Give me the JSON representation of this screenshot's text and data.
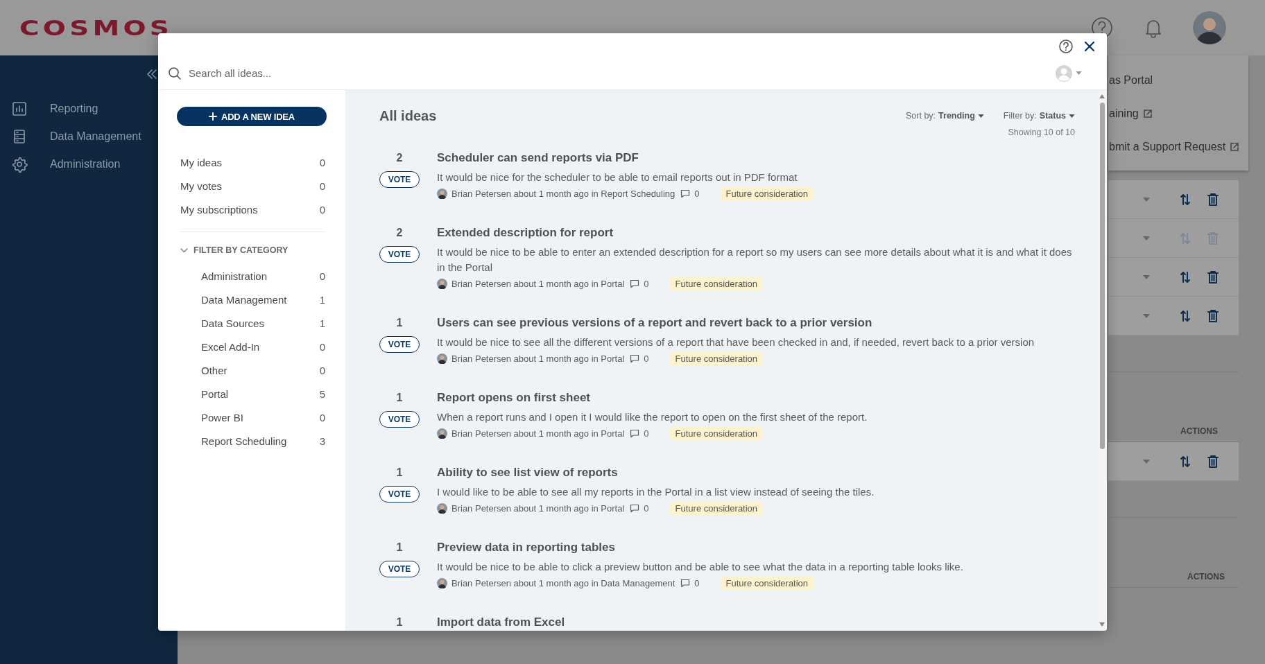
{
  "header": {
    "logo": "COSMOS"
  },
  "sidebar": {
    "items": [
      {
        "label": "Reporting"
      },
      {
        "label": "Data Management"
      },
      {
        "label": "Administration"
      }
    ]
  },
  "help_menu": {
    "items": [
      {
        "label": "as Portal",
        "external": false
      },
      {
        "label": "aining",
        "external": true
      },
      {
        "label": "bmit a Support Request",
        "external": true
      }
    ]
  },
  "background_tables": [
    {
      "rows": [
        {
          "disabled": false
        },
        {
          "disabled": true
        },
        {
          "disabled": false
        },
        {
          "disabled": false
        }
      ]
    },
    {
      "actions_header": "ACTIONS",
      "rows": [
        {
          "disabled": false
        }
      ]
    },
    {
      "actions_header": "ACTIONS"
    }
  ],
  "ideas_modal": {
    "search": {
      "placeholder": "Search all ideas..."
    },
    "add_button": "ADD A NEW IDEA",
    "my_lists": [
      {
        "label": "My ideas",
        "count": "0"
      },
      {
        "label": "My votes",
        "count": "0"
      },
      {
        "label": "My subscriptions",
        "count": "0"
      }
    ],
    "category_filter": {
      "title": "FILTER BY CATEGORY",
      "expanded": true,
      "categories": [
        {
          "label": "Administration",
          "count": "0"
        },
        {
          "label": "Data Management",
          "count": "1"
        },
        {
          "label": "Data Sources",
          "count": "1"
        },
        {
          "label": "Excel Add-In",
          "count": "0"
        },
        {
          "label": "Other",
          "count": "0"
        },
        {
          "label": "Portal",
          "count": "5"
        },
        {
          "label": "Power BI",
          "count": "0"
        },
        {
          "label": "Report Scheduling",
          "count": "3"
        }
      ]
    },
    "heading": "All ideas",
    "sort": {
      "label": "Sort by:",
      "value": "Trending"
    },
    "filter": {
      "label": "Filter by:",
      "value": "Status"
    },
    "showing": "Showing 10 of 10",
    "ideas": [
      {
        "votes": "2",
        "title": "Scheduler can send reports via PDF",
        "vote_label": "VOTE",
        "description": "It would be nice for the scheduler to be able to email reports out in PDF format",
        "meta": "Brian Petersen about 1 month ago in Report Scheduling",
        "comments": "0",
        "status": "Future consideration"
      },
      {
        "votes": "2",
        "title": "Extended description for report",
        "vote_label": "VOTE",
        "description": "It would be nice to be able to enter an extended description for a report so my users can see more details about what it is and what it does in the Portal",
        "meta": "Brian Petersen about 1 month ago in Portal",
        "comments": "0",
        "status": "Future consideration"
      },
      {
        "votes": "1",
        "title": "Users can see previous versions of a report and revert back to a prior version",
        "vote_label": "VOTE",
        "description": "It would be nice to see all the different versions of a report that have been checked in and, if needed, revert back to a prior version",
        "meta": "Brian Petersen about 1 month ago in Portal",
        "comments": "0",
        "status": "Future consideration"
      },
      {
        "votes": "1",
        "title": "Report opens on first sheet",
        "vote_label": "VOTE",
        "description": "When a report runs and I open it I would like the report to open on the first sheet of the report.",
        "meta": "Brian Petersen about 1 month ago in Portal",
        "comments": "0",
        "status": "Future consideration"
      },
      {
        "votes": "1",
        "title": "Ability to see list view of reports",
        "vote_label": "VOTE",
        "description": "I would like to be able to see all my reports in the Portal in a list view instead of seeing the tiles.",
        "meta": "Brian Petersen about 1 month ago in Portal",
        "comments": "0",
        "status": "Future consideration"
      },
      {
        "votes": "1",
        "title": "Preview data in reporting tables",
        "vote_label": "VOTE",
        "description": "It would be nice to be able to click a preview button and be able to see what the data in a reporting table looks like.",
        "meta": "Brian Petersen about 1 month ago in Data Management",
        "comments": "0",
        "status": "Future consideration"
      },
      {
        "votes": "1",
        "title": "Import data from Excel"
      }
    ]
  }
}
